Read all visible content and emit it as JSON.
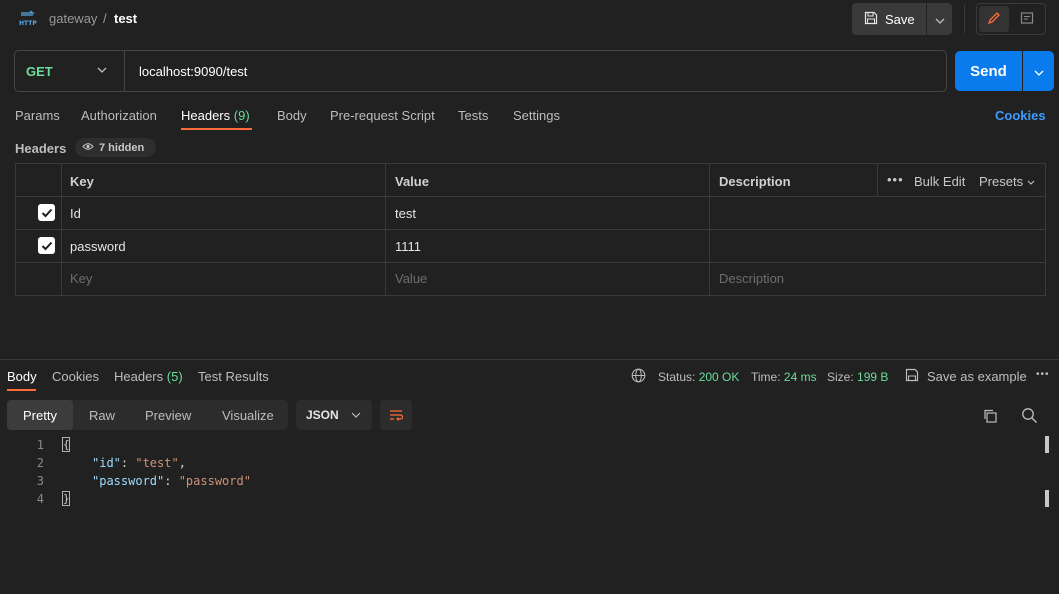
{
  "breadcrumb": {
    "collection": "gateway",
    "separator": "/",
    "request": "test"
  },
  "toolbar": {
    "save_label": "Save"
  },
  "request": {
    "method": "GET",
    "url": "localhost:9090/test",
    "send_label": "Send"
  },
  "request_tabs": {
    "params": "Params",
    "authorization": "Authorization",
    "headers": "Headers",
    "headers_count": "(9)",
    "body": "Body",
    "prerequest": "Pre-request Script",
    "tests": "Tests",
    "settings": "Settings",
    "cookies": "Cookies"
  },
  "headers_section": {
    "label": "Headers",
    "hidden": "7 hidden"
  },
  "headers_table": {
    "columns": {
      "key": "Key",
      "value": "Value",
      "description": "Description"
    },
    "bulk_edit": "Bulk Edit",
    "presets": "Presets",
    "rows": [
      {
        "key": "Id",
        "value": "test",
        "description": "",
        "checked": true
      },
      {
        "key": "password",
        "value": "1111",
        "description": "",
        "checked": true
      }
    ],
    "placeholder": {
      "key": "Key",
      "value": "Value",
      "description": "Description"
    }
  },
  "response_tabs": {
    "body": "Body",
    "cookies": "Cookies",
    "headers": "Headers",
    "headers_count": "(5)",
    "test_results": "Test Results"
  },
  "response_status": {
    "status_label": "Status:",
    "status_value": "200 OK",
    "time_label": "Time:",
    "time_value": "24 ms",
    "size_label": "Size:",
    "size_value": "199 B",
    "save_example": "Save as example"
  },
  "format": {
    "pretty": "Pretty",
    "raw": "Raw",
    "preview": "Preview",
    "visualize": "Visualize",
    "type": "JSON"
  },
  "response_body": {
    "line_numbers": [
      "1",
      "2",
      "3",
      "4"
    ],
    "open_brace": "{",
    "close_brace": "}",
    "entries": [
      {
        "key": "\"id\"",
        "value": "\"test\"",
        "trail": ","
      },
      {
        "key": "\"password\"",
        "value": "\"password\"",
        "trail": ""
      }
    ]
  },
  "colors": {
    "accent": "#ff6c37",
    "send": "#097bed",
    "success": "#6bdd9a",
    "link": "#3d9bff"
  }
}
